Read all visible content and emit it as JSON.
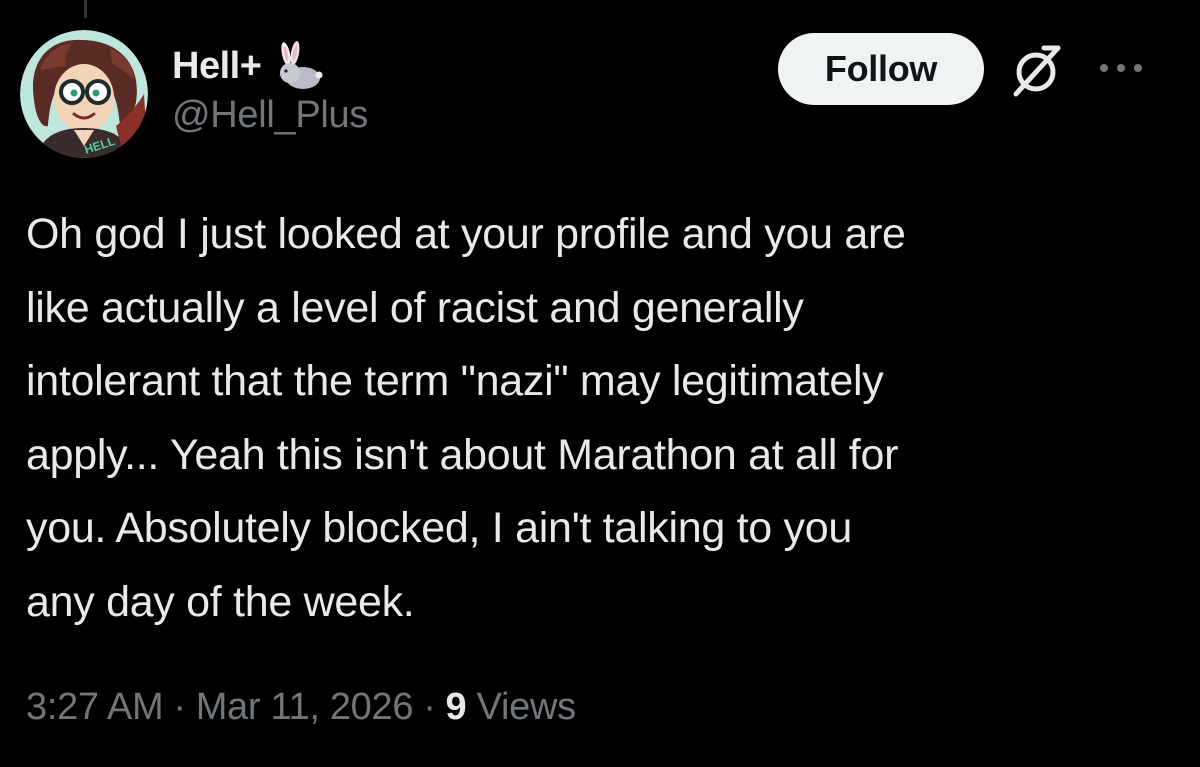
{
  "tweet": {
    "author": {
      "display_name": "Hell+",
      "badge_icon": "bunny-icon",
      "handle": "@Hell_Plus",
      "avatar_text": "HELL"
    },
    "actions": {
      "follow_label": "Follow",
      "grok_icon": "grok-icon",
      "more_icon": "more-options-icon"
    },
    "text_lines": [
      "Oh god I just looked at your profile and you are",
      "like actually a level of racist and generally",
      "intolerant that the term \"nazi\" may legitimately",
      "apply... Yeah this isn't about Marathon at all for",
      "you. Absolutely blocked, I ain't talking to you",
      "any day of the week."
    ],
    "meta": {
      "time": "3:27 AM",
      "separator": "·",
      "date": "Mar 11, 2026",
      "views_count": "9",
      "views_label": "Views"
    }
  },
  "colors": {
    "background": "#000000",
    "text_primary": "#e7e9ea",
    "text_secondary": "#71767b",
    "follow_bg": "#eff3f4",
    "follow_text": "#0f1419"
  }
}
